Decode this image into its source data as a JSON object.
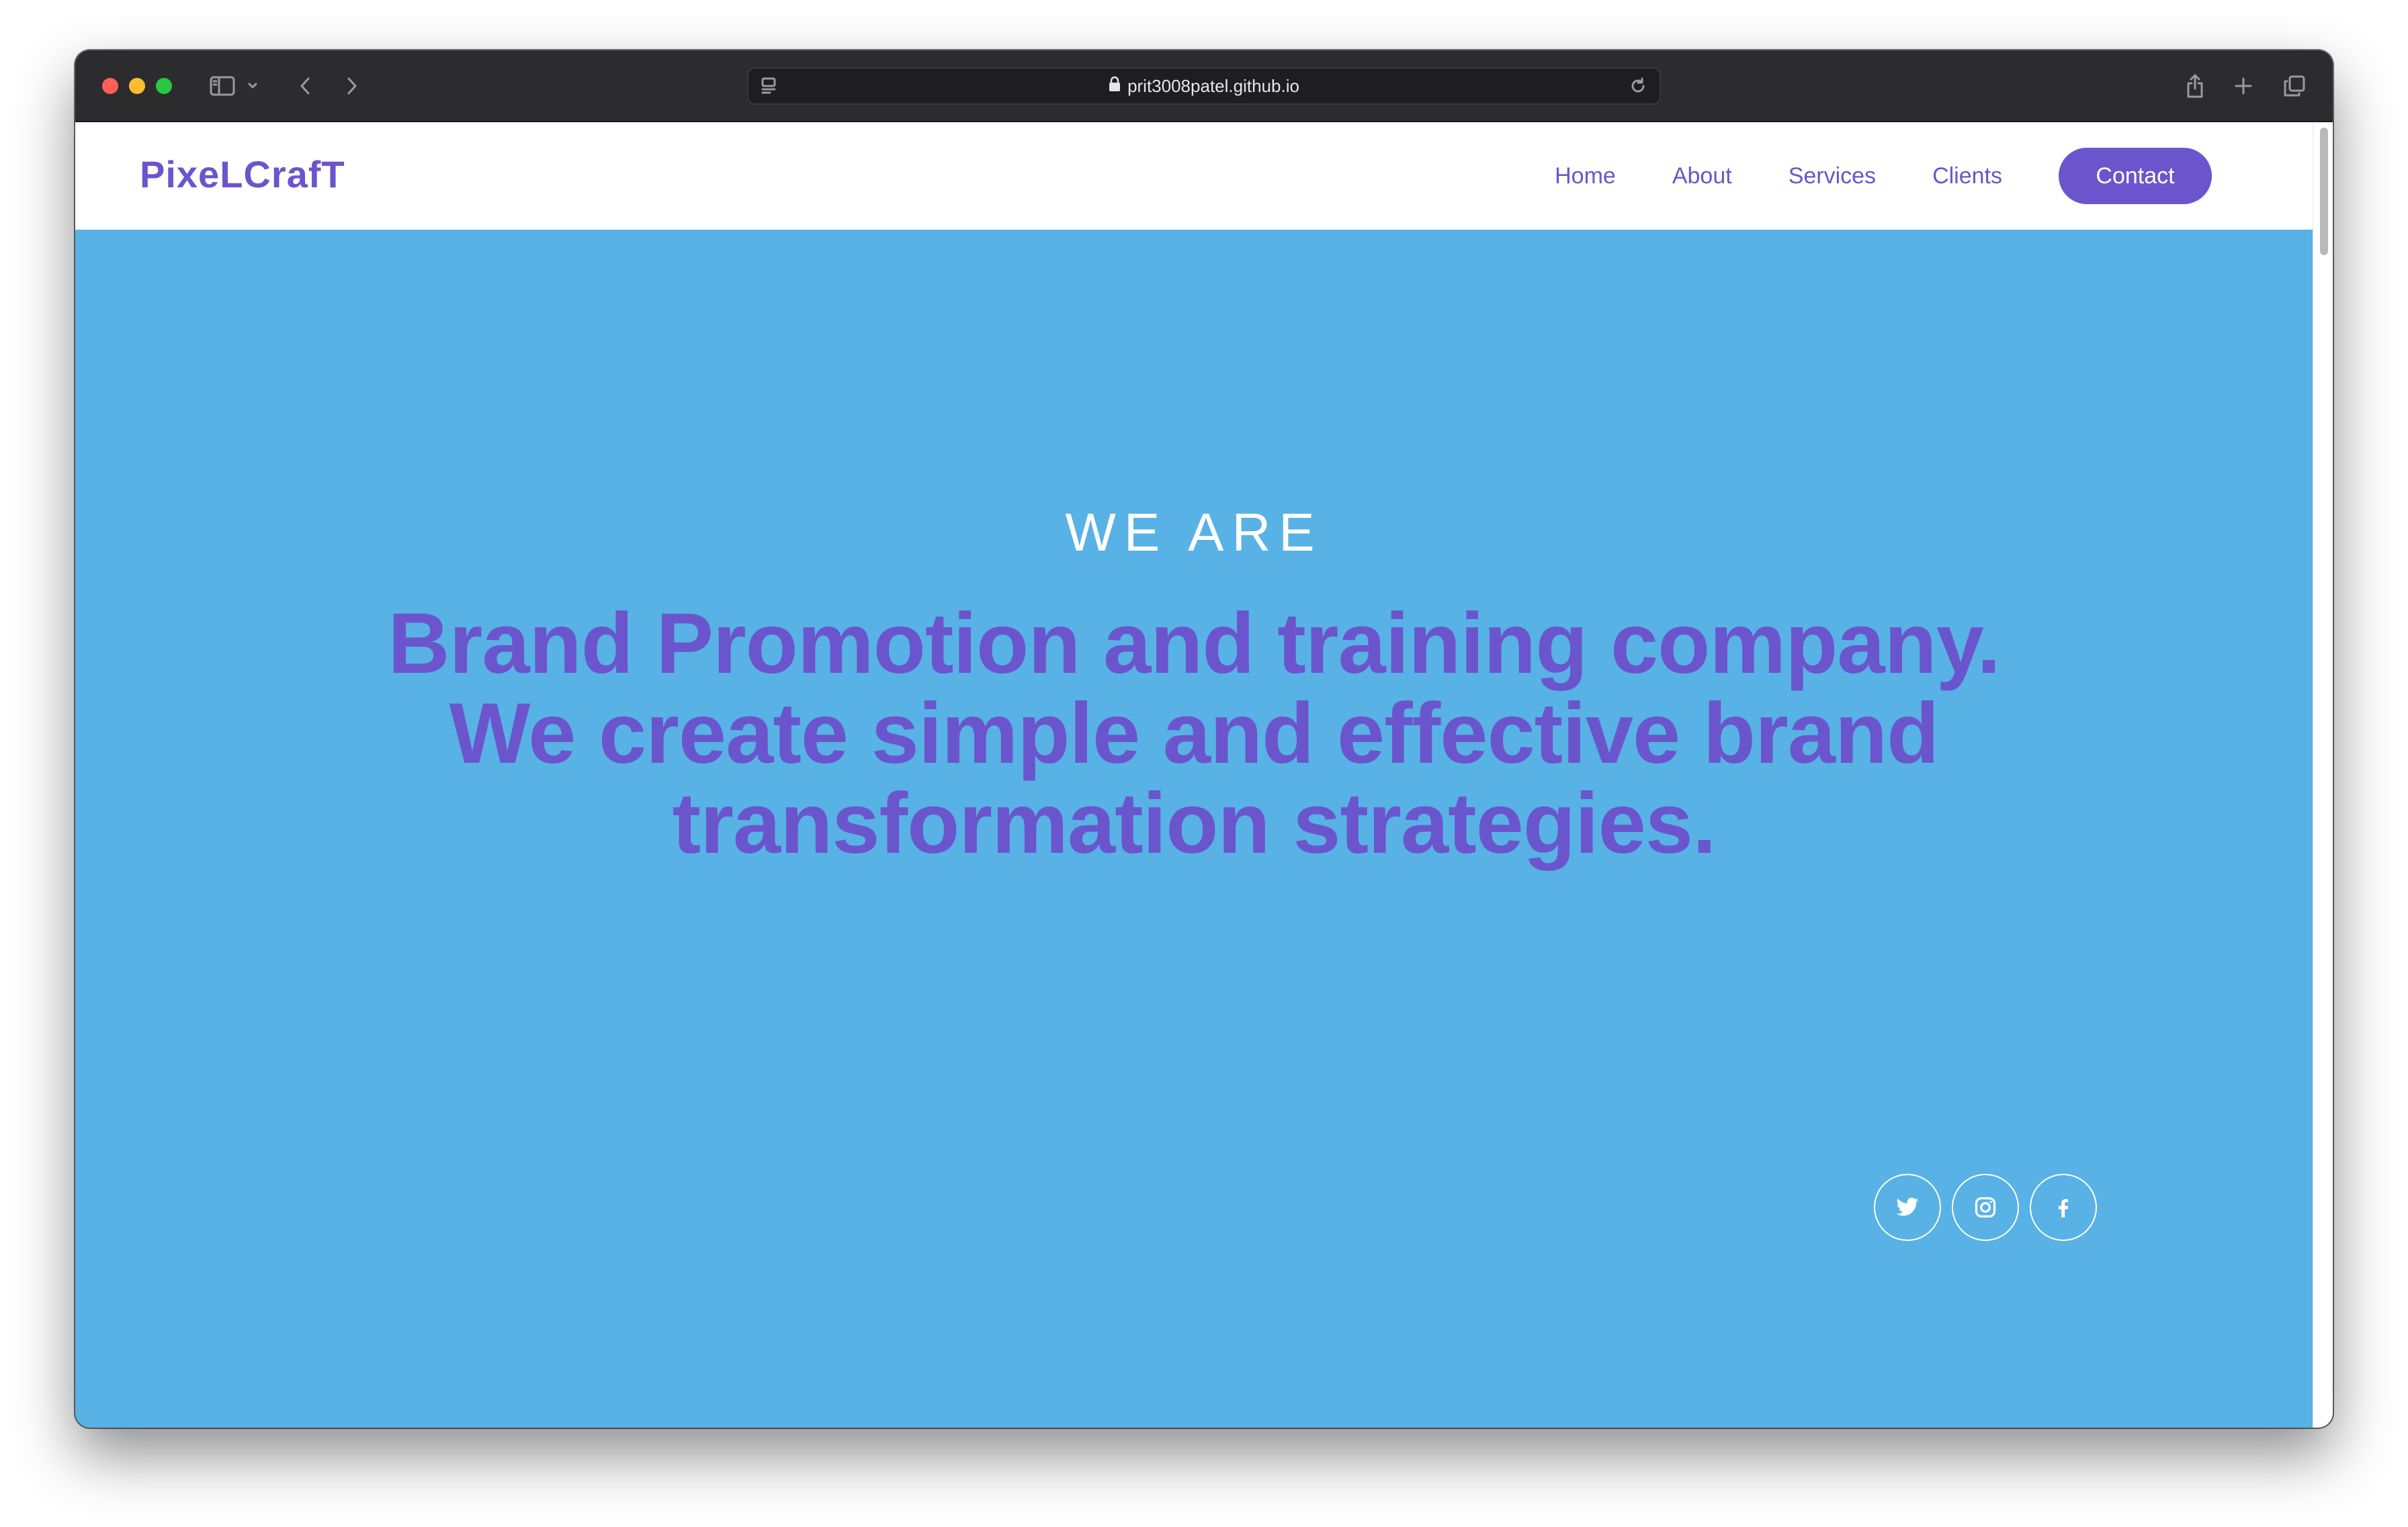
{
  "browser": {
    "url": "prit3008patel.github.io",
    "icons": [
      "sidebar-icon",
      "chevron-down-icon",
      "back-icon",
      "forward-icon",
      "reader-icon",
      "lock-icon",
      "reload-icon",
      "share-icon",
      "new-tab-icon",
      "tabs-overview-icon"
    ]
  },
  "site": {
    "logo": "PixeLCrafT",
    "nav": {
      "home": "Home",
      "about": "About",
      "services": "Services",
      "clients": "Clients",
      "contact": "Contact"
    },
    "hero": {
      "eyebrow": "WE ARE",
      "line1": "Brand Promotion and training company.",
      "line2": "We create simple and effective brand",
      "line3": "transformation strategies."
    },
    "socials": [
      "twitter-icon",
      "instagram-icon",
      "facebook-icon"
    ],
    "colors": {
      "accent": "#6b55cc",
      "hero_background": "#58b2e5",
      "navbar_background": "#ffffff"
    }
  }
}
